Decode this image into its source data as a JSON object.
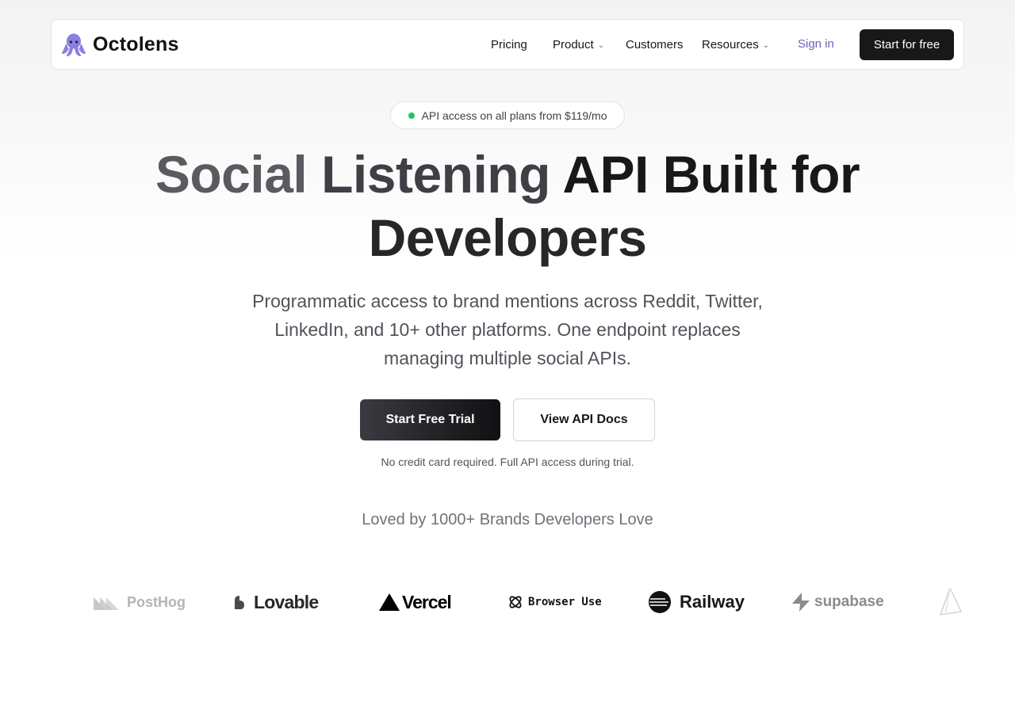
{
  "brand": {
    "name": "Octolens",
    "logo_icon": "octopus-icon",
    "accent": "#7c6fd6"
  },
  "nav": {
    "links": [
      {
        "label": "Pricing",
        "has_caret": false
      },
      {
        "label": "Product",
        "has_caret": true
      },
      {
        "label": "Customers",
        "has_caret": false
      },
      {
        "label": "Resources",
        "has_caret": true
      }
    ],
    "caret_glyph": "⌄",
    "signin": "Sign in",
    "cta": "Start for free"
  },
  "badge": {
    "text": "API access on all plans from $119/mo",
    "dot_color": "#22c55e"
  },
  "hero": {
    "title_part1": "Social ",
    "title_part2": "Listening ",
    "title_part3": "API Built for",
    "title_line2": "Developers",
    "subtitle": "Programmatic access to brand mentions across Reddit, Twitter, LinkedIn, and 10+ other platforms. One endpoint replaces managing multiple social APIs.",
    "primary_cta": "Start Free Trial",
    "secondary_cta": "View API Docs",
    "note": "No credit card required. Full API access during trial."
  },
  "social_proof": {
    "heading": "Loved by 1000+ Brands Developers Love",
    "logos": [
      {
        "name": "PostHog",
        "icon": "posthog-icon"
      },
      {
        "name": "Lovable",
        "icon": "lovable-heart-icon"
      },
      {
        "name": "Vercel",
        "icon": "vercel-triangle-icon"
      },
      {
        "name": "Browser Use",
        "icon": "browser-use-icon"
      },
      {
        "name": "Railway",
        "icon": "railway-icon"
      },
      {
        "name": "supabase",
        "icon": "supabase-bolt-icon"
      }
    ]
  }
}
